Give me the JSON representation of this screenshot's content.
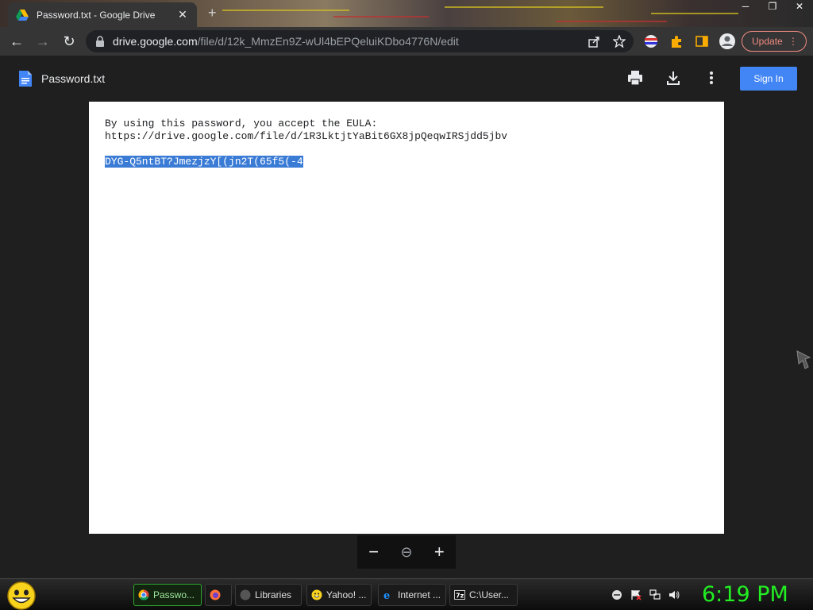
{
  "browser": {
    "tab": {
      "title": "Password.txt - Google Drive",
      "close": "✕"
    },
    "new_tab": "+",
    "window_controls": [
      "─",
      "❐",
      "✕"
    ],
    "nav": {
      "back": "←",
      "forward": "→",
      "reload": "↻"
    },
    "address": {
      "host": "drive.google.com",
      "path": "/file/d/12k_MmzEn9Z-wUl4bEPQeluiKDbo4776N/edit"
    },
    "update_label": "Update",
    "menu": "⋮"
  },
  "viewer": {
    "file_name": "Password.txt",
    "signin_label": "Sign In"
  },
  "document": {
    "lines": [
      "By using this password, you accept the EULA:",
      "https://drive.google.com/file/d/1R3LktjtYaBit6GX8jpQeqwIRSjdd5jbv",
      "",
      "DYG-Q5ntBT?JmezjzY[(jn2T(65f5(-4"
    ]
  },
  "zoom": {
    "out": "−",
    "fit": "⊖",
    "in": "+"
  },
  "taskbar": {
    "tasks": [
      {
        "label": "Passwo...",
        "icon": "chrome-icon"
      },
      {
        "label": "",
        "icon": "firefox-icon"
      },
      {
        "label": "Libraries",
        "icon": "libraries-icon"
      },
      {
        "label": "Yahoo! ...",
        "icon": "yahoo-messenger-icon"
      },
      {
        "label": "Internet ...",
        "icon": "internet-explorer-icon"
      },
      {
        "label": "C:\\User...",
        "icon": "7zip-icon"
      }
    ],
    "clock": "6:19 PM"
  },
  "colors": {
    "selection": "#3a7bd5",
    "signin": "#4285f4",
    "update": "#f28b82",
    "clock": "#22ee22"
  }
}
